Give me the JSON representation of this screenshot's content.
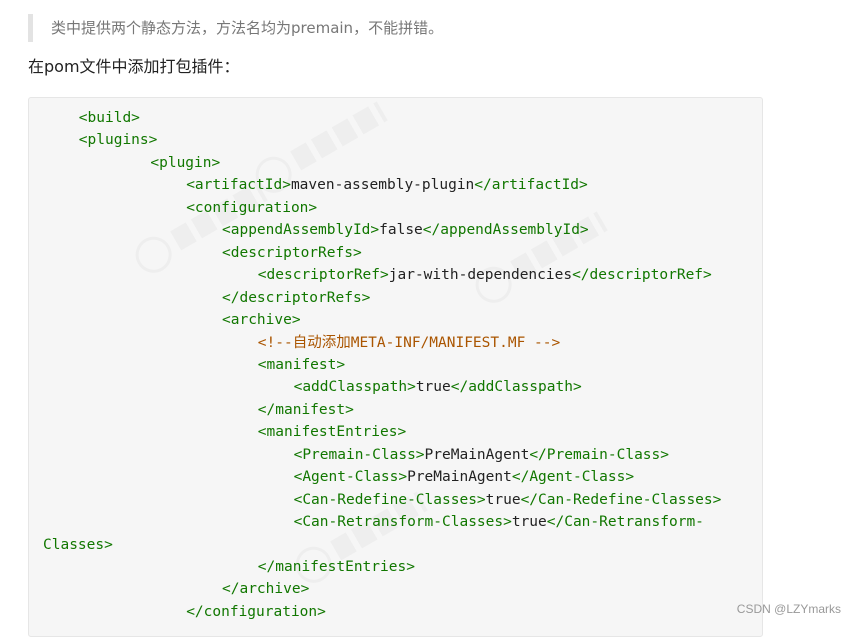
{
  "quote_text": "类中提供两个静态方法，方法名均为premain，不能拼错。",
  "paragraph_text": "在pom文件中添加打包插件：",
  "code_lines": [
    {
      "indent": 4,
      "segments": [
        {
          "t": "tag",
          "s": "<build>"
        }
      ]
    },
    {
      "indent": 4,
      "segments": [
        {
          "t": "tag",
          "s": "<plugins>"
        }
      ]
    },
    {
      "indent": 12,
      "segments": [
        {
          "t": "tag",
          "s": "<plugin>"
        }
      ]
    },
    {
      "indent": 16,
      "segments": [
        {
          "t": "tag",
          "s": "<artifactId>"
        },
        {
          "t": "val",
          "s": "maven-assembly-plugin"
        },
        {
          "t": "tag",
          "s": "</artifactId>"
        }
      ]
    },
    {
      "indent": 16,
      "segments": [
        {
          "t": "tag",
          "s": "<configuration>"
        }
      ]
    },
    {
      "indent": 20,
      "segments": [
        {
          "t": "tag",
          "s": "<appendAssemblyId>"
        },
        {
          "t": "val",
          "s": "false"
        },
        {
          "t": "tag",
          "s": "</appendAssemblyId>"
        }
      ]
    },
    {
      "indent": 20,
      "segments": [
        {
          "t": "tag",
          "s": "<descriptorRefs>"
        }
      ]
    },
    {
      "indent": 24,
      "segments": [
        {
          "t": "tag",
          "s": "<descriptorRef>"
        },
        {
          "t": "val",
          "s": "jar-with-dependencies"
        },
        {
          "t": "tag",
          "s": "</descriptorRef>"
        }
      ]
    },
    {
      "indent": 20,
      "segments": [
        {
          "t": "tag",
          "s": "</descriptorRefs>"
        }
      ]
    },
    {
      "indent": 20,
      "segments": [
        {
          "t": "tag",
          "s": "<archive>"
        }
      ]
    },
    {
      "indent": 24,
      "segments": [
        {
          "t": "comment",
          "s": "<!--自动添加META-INF/MANIFEST.MF -->"
        }
      ]
    },
    {
      "indent": 24,
      "segments": [
        {
          "t": "tag",
          "s": "<manifest>"
        }
      ]
    },
    {
      "indent": 28,
      "segments": [
        {
          "t": "tag",
          "s": "<addClasspath>"
        },
        {
          "t": "val",
          "s": "true"
        },
        {
          "t": "tag",
          "s": "</addClasspath>"
        }
      ]
    },
    {
      "indent": 24,
      "segments": [
        {
          "t": "tag",
          "s": "</manifest>"
        }
      ]
    },
    {
      "indent": 24,
      "segments": [
        {
          "t": "tag",
          "s": "<manifestEntries>"
        }
      ]
    },
    {
      "indent": 28,
      "segments": [
        {
          "t": "tag",
          "s": "<Premain-Class>"
        },
        {
          "t": "val",
          "s": "PreMainAgent"
        },
        {
          "t": "tag",
          "s": "</Premain-Class>"
        }
      ]
    },
    {
      "indent": 28,
      "segments": [
        {
          "t": "tag",
          "s": "<Agent-Class>"
        },
        {
          "t": "val",
          "s": "PreMainAgent"
        },
        {
          "t": "tag",
          "s": "</Agent-Class>"
        }
      ]
    },
    {
      "indent": 28,
      "segments": [
        {
          "t": "tag",
          "s": "<Can-Redefine-Classes>"
        },
        {
          "t": "val",
          "s": "true"
        },
        {
          "t": "tag",
          "s": "</Can-Redefine-Classes>"
        }
      ]
    },
    {
      "indent": 28,
      "segments": [
        {
          "t": "tag",
          "s": "<Can-Retransform-Classes>"
        },
        {
          "t": "val",
          "s": "true"
        },
        {
          "t": "tag",
          "s": "</Can-Retransform-"
        }
      ]
    },
    {
      "indent": 0,
      "segments": [
        {
          "t": "tag",
          "s": "Classes>"
        }
      ]
    },
    {
      "indent": 24,
      "segments": [
        {
          "t": "tag",
          "s": "</manifestEntries>"
        }
      ]
    },
    {
      "indent": 20,
      "segments": [
        {
          "t": "tag",
          "s": "</archive>"
        }
      ]
    },
    {
      "indent": 16,
      "segments": [
        {
          "t": "tag",
          "s": "</configuration>"
        }
      ]
    }
  ],
  "colors": {
    "tag": "#117700",
    "value": "#222222",
    "comment": "#aa5500"
  },
  "watermark_text": "CSDN @LZYmarks"
}
